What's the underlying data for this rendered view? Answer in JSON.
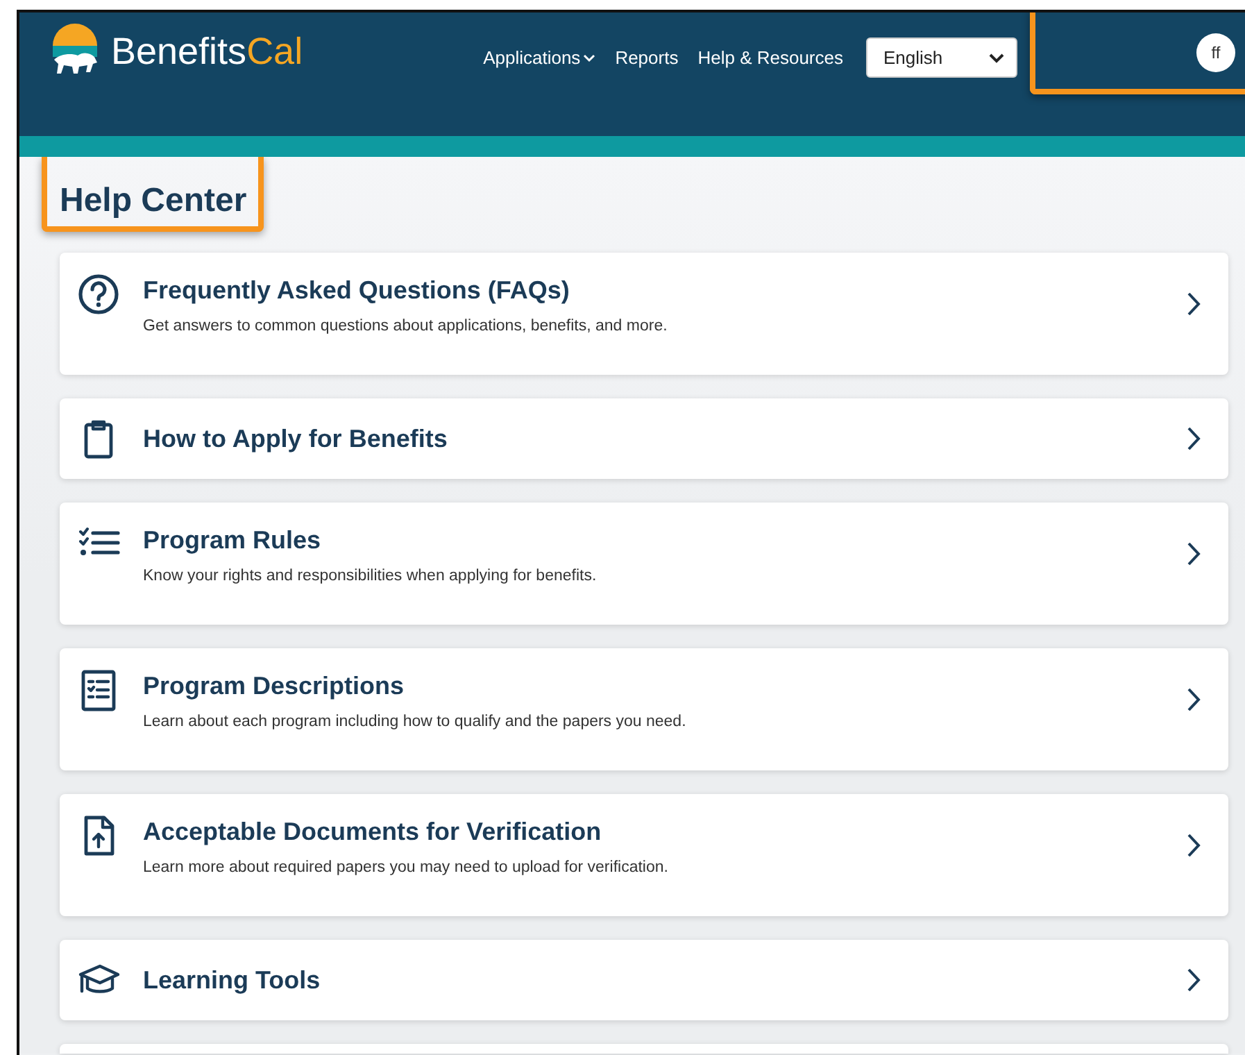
{
  "header": {
    "logo": {
      "part1": "Benefits",
      "part2": "Cal"
    },
    "nav": [
      {
        "label": "Applications",
        "has_menu": true
      },
      {
        "label": "Reports",
        "has_menu": false
      },
      {
        "label": "Help & Resources",
        "has_menu": false
      }
    ],
    "language": {
      "value": "English"
    },
    "avatar": "ff",
    "avatar_highlighted": true
  },
  "page_title": "Help Center",
  "page_title_highlighted": true,
  "cards": [
    {
      "title": "Frequently Asked Questions (FAQs)",
      "description": "Get answers to common questions about applications, benefits, and more."
    },
    {
      "title": "How to Apply for Benefits"
    },
    {
      "title": "Program Rules",
      "description": "Know your rights and responsibilities when applying for benefits."
    },
    {
      "title": "Program Descriptions",
      "description": "Learn about each program including how to qualify and the papers you need."
    },
    {
      "title": "Acceptable Documents for Verification",
      "description": "Learn more about required papers you may need to upload for verification."
    },
    {
      "title": "Learning Tools"
    }
  ],
  "more_below": true
}
